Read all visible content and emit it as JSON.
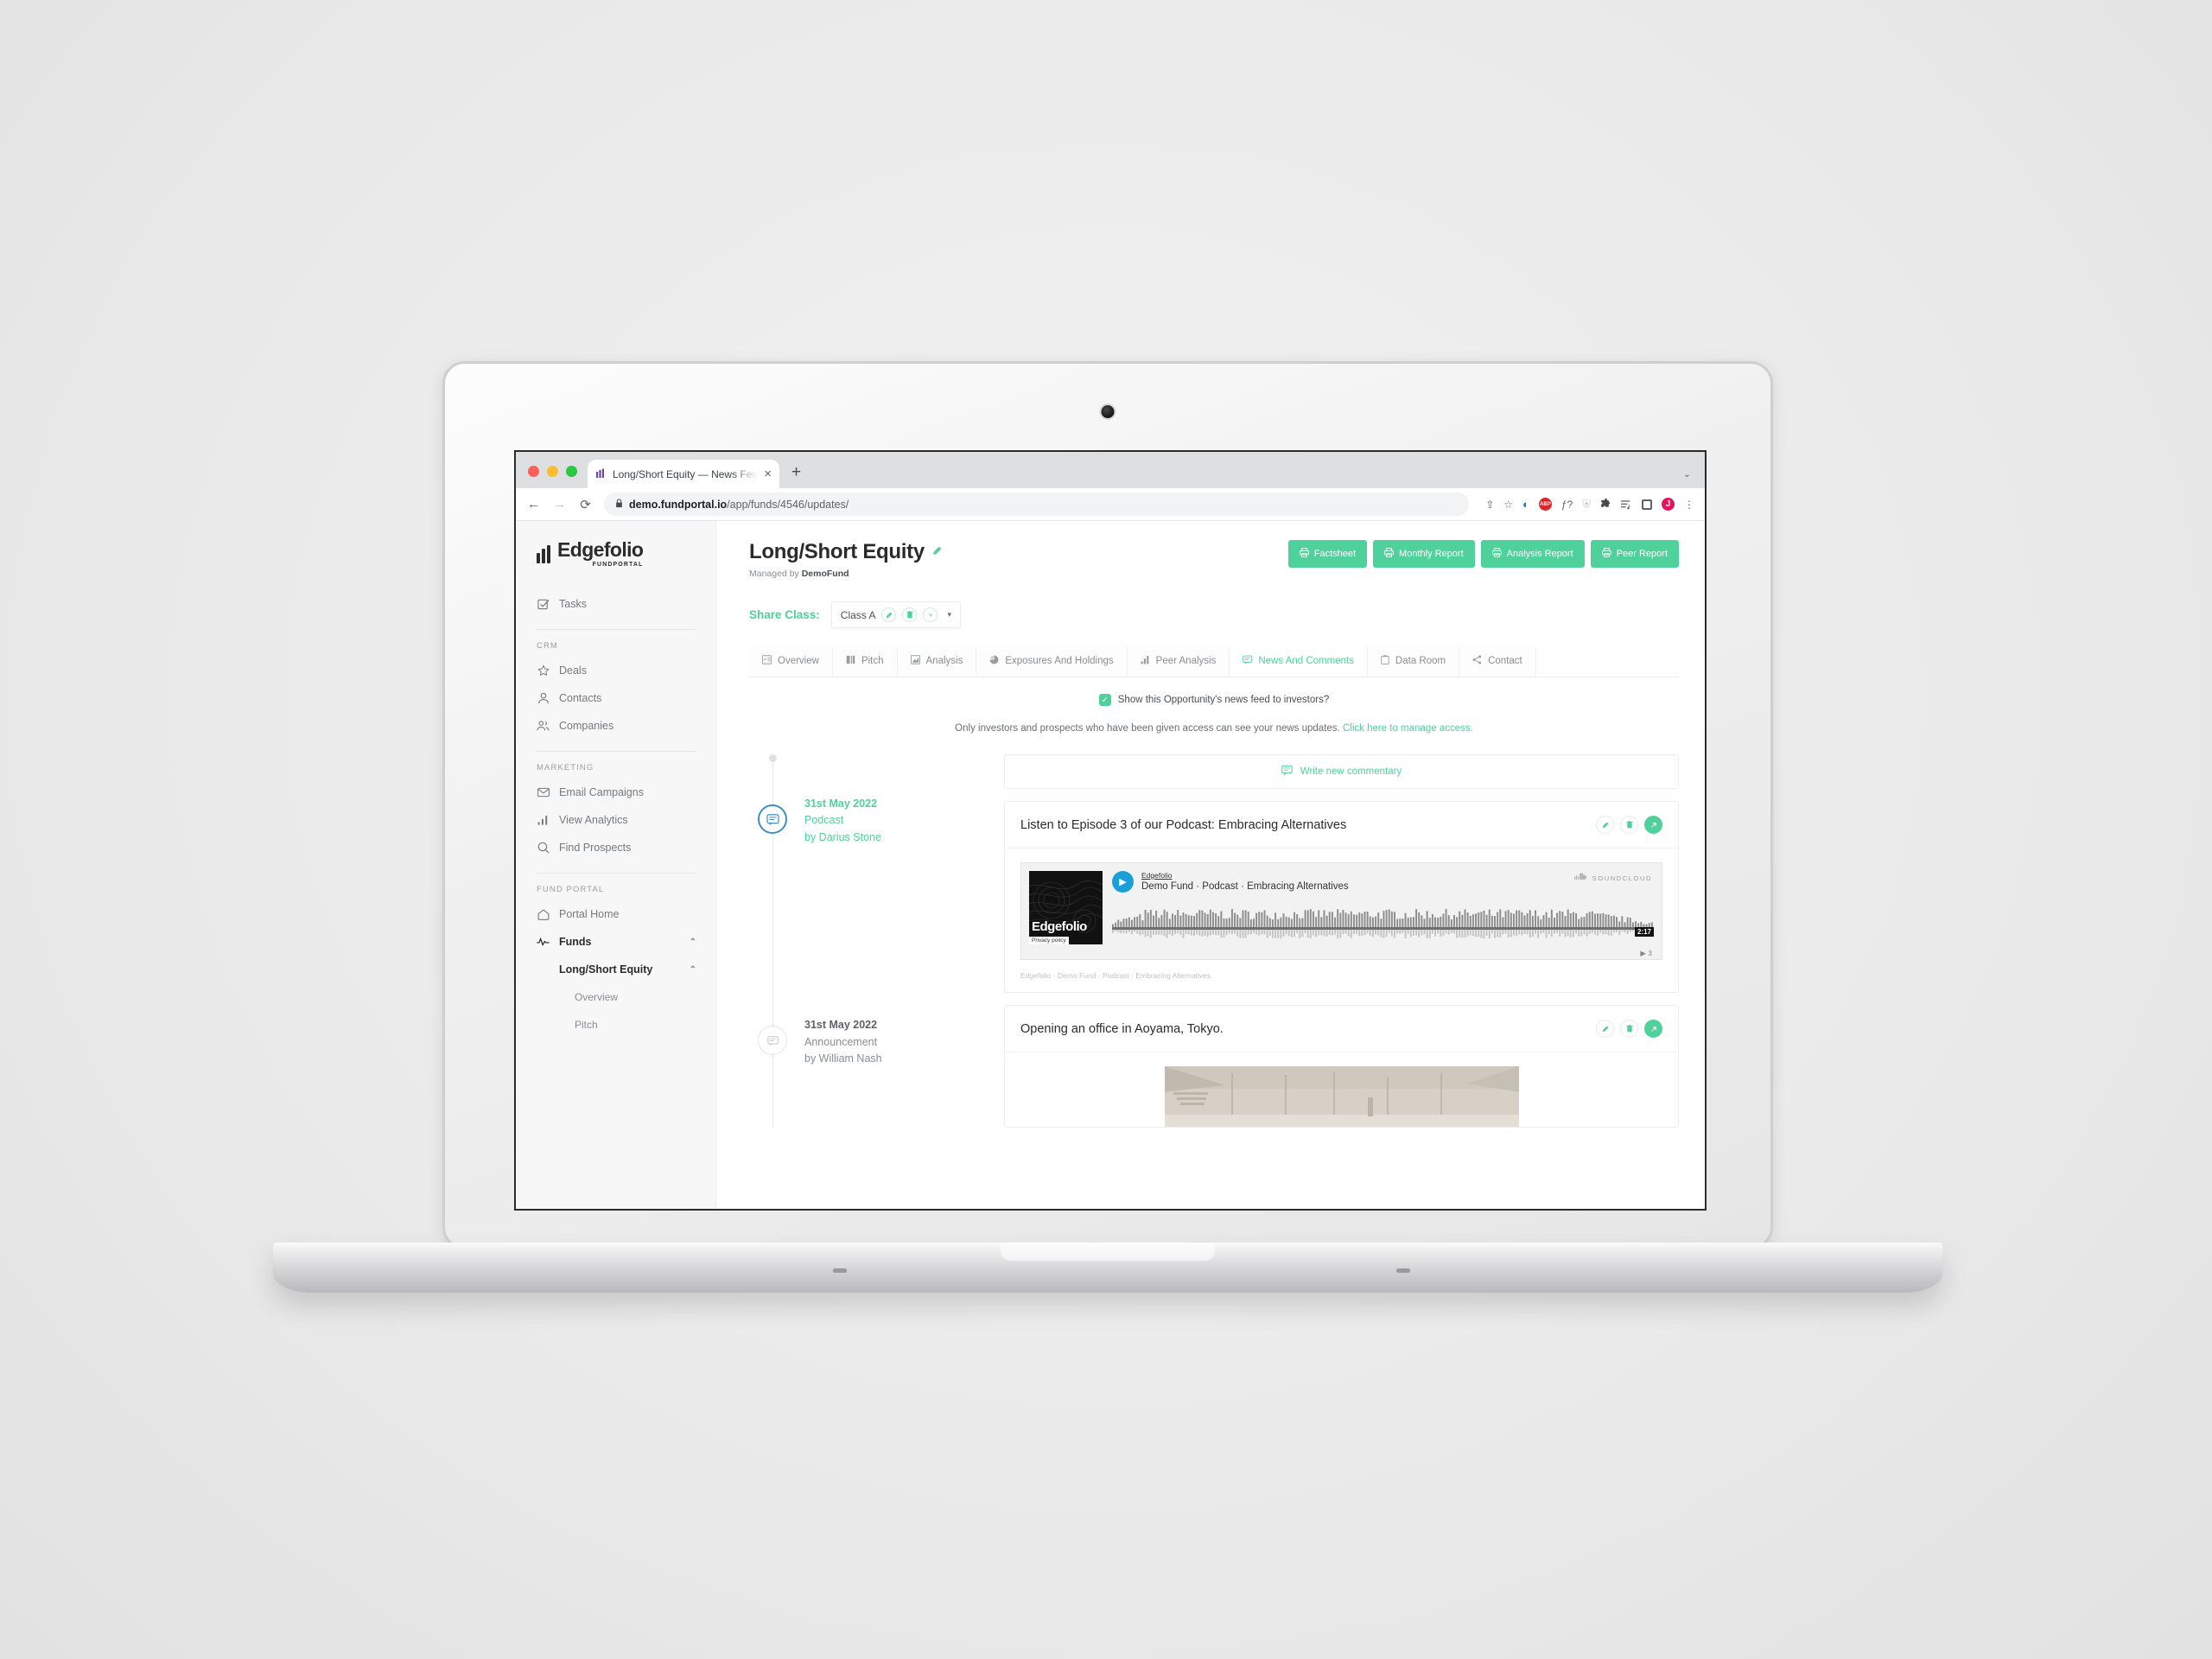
{
  "browser": {
    "tab_title": "Long/Short Equity — News Fee",
    "tab_close": "×",
    "new_tab": "+",
    "back": "←",
    "forward": "→",
    "reload": "⟳",
    "lock": "🔒",
    "url_domain": "demo.fundportal.io",
    "url_path": "/app/funds/4546/updates/",
    "chevron": "⌄",
    "extensions": {
      "share": "⇧",
      "bookmark": "☆",
      "sync": "◐",
      "adblock": "ABP",
      "fonts": "ƒ?",
      "shield": "⛨",
      "puzzle": "🧩",
      "reading_list": "≡",
      "side_panel": "",
      "avatar_initial": "J",
      "menu": "⋮"
    }
  },
  "sidebar": {
    "logo_name": "Edgefolio",
    "logo_sub": "FUNDPORTAL",
    "top_items": [
      {
        "label": "Tasks",
        "icon": "checkbox-icon",
        "glyph": "☑"
      }
    ],
    "groups": [
      {
        "heading": "CRM",
        "items": [
          {
            "label": "Deals",
            "icon": "star-icon",
            "glyph": "☆"
          },
          {
            "label": "Contacts",
            "icon": "person-icon",
            "glyph": "👤"
          },
          {
            "label": "Companies",
            "icon": "people-icon",
            "glyph": "👥"
          }
        ]
      },
      {
        "heading": "MARKETING",
        "items": [
          {
            "label": "Email Campaigns",
            "icon": "envelope-icon",
            "glyph": "✉"
          },
          {
            "label": "View Analytics",
            "icon": "bar-chart-icon",
            "glyph": "▁▃▅"
          },
          {
            "label": "Find Prospects",
            "icon": "search-icon",
            "glyph": "🔍"
          }
        ]
      },
      {
        "heading": "FUND PORTAL",
        "items": [
          {
            "label": "Portal Home",
            "icon": "home-icon",
            "glyph": "⌂"
          },
          {
            "label": "Funds",
            "icon": "activity-icon",
            "glyph": "〰",
            "caret": "⌃"
          }
        ]
      }
    ],
    "fund_sub": {
      "label": "Long/Short Equity",
      "caret": "⌃",
      "children": [
        {
          "label": "Overview"
        },
        {
          "label": "Pitch"
        }
      ]
    }
  },
  "header": {
    "title": "Long/Short Equity",
    "edit_icon": "✎",
    "managed_prefix": "Managed by ",
    "managed_by": "DemoFund",
    "actions": [
      {
        "label": "Factsheet",
        "icon": "print-icon"
      },
      {
        "label": "Monthly Report",
        "icon": "print-icon"
      },
      {
        "label": "Analysis Report",
        "icon": "print-icon"
      },
      {
        "label": "Peer Report",
        "icon": "print-icon"
      }
    ]
  },
  "share_class": {
    "label": "Share Class:",
    "value": "Class A",
    "edit": "✎",
    "delete": "🗑",
    "add": "+",
    "caret": "▾"
  },
  "tabs": [
    {
      "label": "Overview",
      "icon": "slide-icon",
      "glyph": "▣",
      "active": false
    },
    {
      "label": "Pitch",
      "icon": "book-icon",
      "glyph": "❚❚",
      "active": false
    },
    {
      "label": "Analysis",
      "icon": "area-chart-icon",
      "glyph": "◸",
      "active": false
    },
    {
      "label": "Exposures And Holdings",
      "icon": "pie-chart-icon",
      "glyph": "◑",
      "active": false
    },
    {
      "label": "Peer Analysis",
      "icon": "bar-chart-icon",
      "glyph": "▃▅",
      "active": false
    },
    {
      "label": "News And Comments",
      "icon": "comment-icon",
      "glyph": "💬",
      "active": true
    },
    {
      "label": "Data Room",
      "icon": "document-icon",
      "glyph": "▤",
      "active": false
    },
    {
      "label": "Contact",
      "icon": "share-icon",
      "glyph": "⋖",
      "active": false
    }
  ],
  "feed": {
    "checkbox_checked": true,
    "checkbox_glyph": "✓",
    "visibility_label": "Show this Opportunity's news feed to investors?",
    "access_note": "Only investors and prospects who have been given access can see your news updates.",
    "access_link": "Click here to manage access.",
    "write_label": "Write new commentary",
    "write_icon": "💬",
    "entries": [
      {
        "date": "31st May 2022",
        "type": "Podcast",
        "by": "by Darius Stone",
        "highlighted": true,
        "node_icon": "comment-icon",
        "title": "Listen to Episode 3 of our Podcast: Embracing Alternatives",
        "actions": {
          "edit": "✎",
          "delete": "🗑",
          "share": "➚"
        },
        "embed": {
          "kind": "soundcloud",
          "artwork_text": "Edgefolio",
          "privacy_label": "Privacy policy",
          "user": "Edgefolio",
          "track": "Demo Fund · Podcast · Embracing Alternatives",
          "brand": "SOUNDCLOUD",
          "duration": "2:17",
          "plays": "3",
          "play_glyph": "▶",
          "caption": "Edgefolio · Demo Fund · Podcast · Embracing Alternatives"
        }
      },
      {
        "date": "31st May 2022",
        "type": "Announcement",
        "by": "by William Nash",
        "highlighted": false,
        "node_icon": "comment-icon",
        "title": "Opening an office in Aoyama, Tokyo.",
        "actions": {
          "edit": "✎",
          "delete": "🗑",
          "share": "➚"
        },
        "embed": {
          "kind": "image"
        }
      }
    ]
  },
  "colors": {
    "accent_green": "#4ed19a",
    "timeline_blue": "#3e8fc4",
    "soundcloud_blue": "#1b9fd8",
    "text_dark": "#2b2b2b",
    "text_muted": "#8a8d90"
  }
}
